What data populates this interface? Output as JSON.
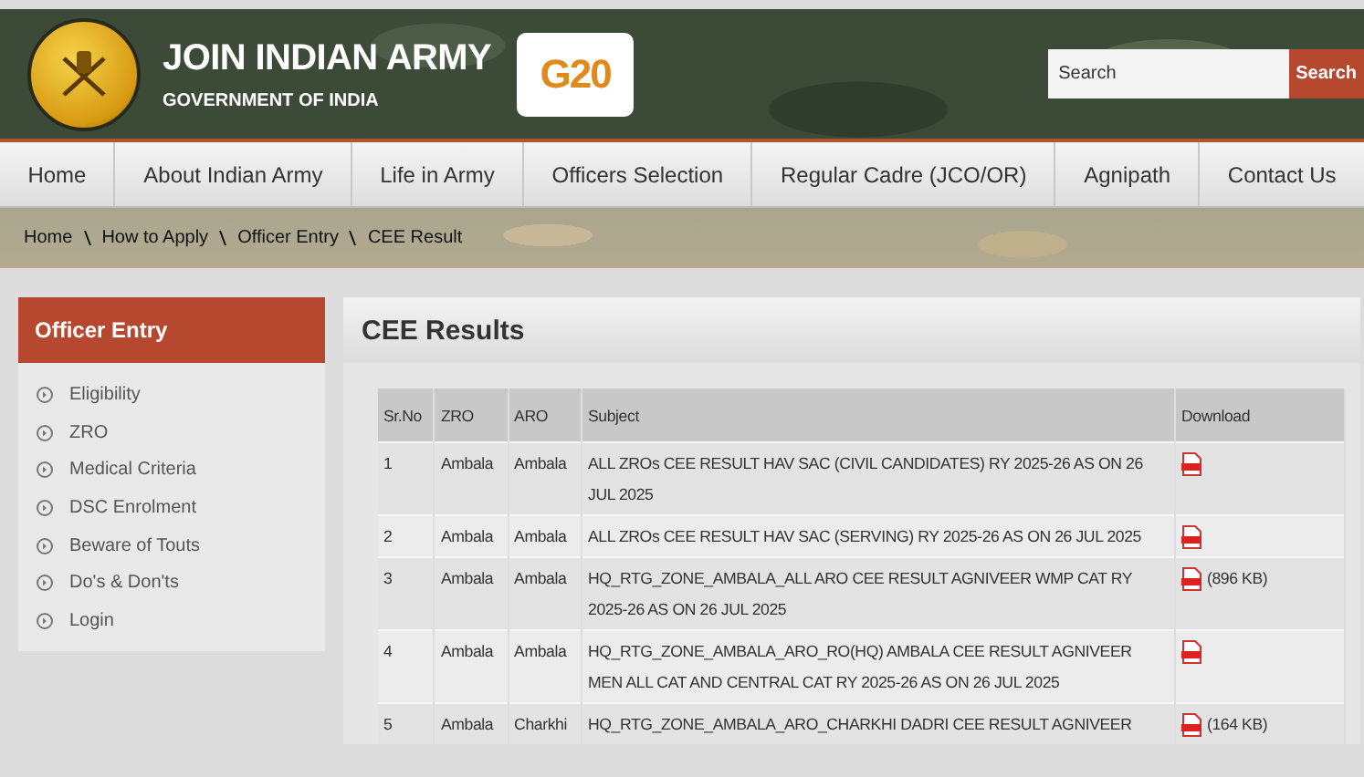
{
  "header": {
    "title": "JOIN INDIAN ARMY",
    "subtitle": "GOVERNMENT OF INDIA",
    "logo_text": "G20",
    "search": {
      "placeholder": "Search",
      "button": "Search"
    }
  },
  "nav": [
    "Home",
    "About Indian Army",
    "Life in Army",
    "Officers Selection",
    "Regular Cadre (JCO/OR)",
    "Agnipath",
    "Contact Us"
  ],
  "breadcrumb": [
    "Home",
    "How to Apply",
    "Officer Entry",
    "CEE Result"
  ],
  "sidebar": {
    "title": "Officer Entry",
    "items": [
      "Eligibility",
      "ZRO",
      "Medical Criteria",
      "DSC Enrolment",
      "Beware of Touts",
      "Do's & Don'ts",
      "Login"
    ]
  },
  "main": {
    "title": "CEE Results",
    "table": {
      "columns": [
        "Sr.No",
        "ZRO",
        "ARO",
        "Subject",
        "Download"
      ],
      "rows": [
        {
          "sr": "1",
          "zro": "Ambala",
          "aro": "Ambala",
          "subject": "ALL ZROs CEE RESULT HAV SAC (CIVIL CANDIDATES) RY 2025-26 AS ON 26 JUL 2025"
        },
        {
          "sr": "2",
          "zro": "Ambala",
          "aro": "Ambala",
          "subject": "ALL ZROs CEE RESULT HAV SAC (SERVING) RY 2025-26 AS ON 26 JUL 2025"
        },
        {
          "sr": "3",
          "zro": "Ambala",
          "aro": "Ambala",
          "subject": "HQ_RTG_ZONE_AMBALA_ALL ARO CEE RESULT AGNIVEER WMP CAT RY 2025-26 AS ON 26 JUL 2025",
          "size": "(896 KB)"
        },
        {
          "sr": "4",
          "zro": "Ambala",
          "aro": "Ambala",
          "subject": "HQ_RTG_ZONE_AMBALA_ARO_RO(HQ) AMBALA CEE RESULT AGNIVEER MEN ALL CAT AND CENTRAL CAT RY 2025-26 AS ON 26 JUL 2025"
        },
        {
          "sr": "5",
          "zro": "Ambala",
          "aro": "Charkhi",
          "subject": "HQ_RTG_ZONE_AMBALA_ARO_CHARKHI DADRI CEE RESULT AGNIVEER",
          "size": "(164 KB)"
        }
      ]
    }
  }
}
